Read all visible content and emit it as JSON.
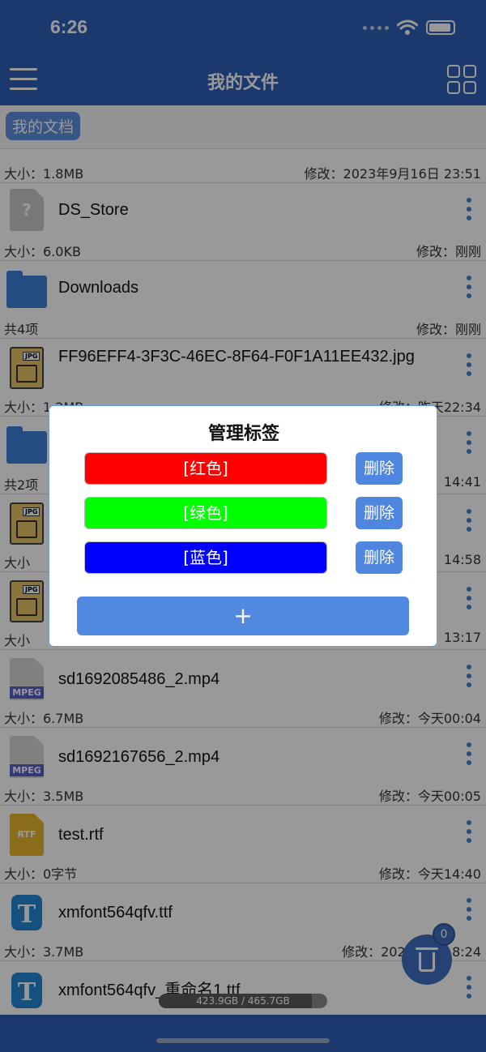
{
  "status_bar": {
    "time": "6:26"
  },
  "nav": {
    "title": "我的文件"
  },
  "breadcrumb": {
    "current": "我的文档"
  },
  "files": [
    {
      "name": "",
      "icon": "generic-file-icon",
      "meta_left": "大小：1.8MB",
      "meta_right": "修改：2023年9月16日 23:51"
    },
    {
      "name": "DS_Store",
      "icon": "unknown-file-icon",
      "glyph": "?",
      "meta_left": "大小：6.0KB",
      "meta_right": "修改：刚刚"
    },
    {
      "name": "Downloads",
      "icon": "folder-icon",
      "meta_left": "共4项",
      "meta_right": "修改：刚刚"
    },
    {
      "name": "FF96EFF4-3F3C-46EC-8F64-F0F1A11EE432.jpg",
      "icon": "jpg-file-icon",
      "tag": "JPG",
      "meta_left": "大小：1.2MB",
      "meta_right": "修改：昨天22:34"
    },
    {
      "name": "",
      "icon": "folder-icon",
      "meta_left": "共2项",
      "meta_right": "14:41"
    },
    {
      "name": "",
      "icon": "jpg-file-icon",
      "tag": "JPG",
      "meta_left": "大小",
      "meta_right": "14:58"
    },
    {
      "name": "",
      "icon": "jpg-file-icon",
      "tag": "JPG",
      "meta_left": "大小",
      "meta_right": "13:17"
    },
    {
      "name": "sd1692085486_2.mp4",
      "icon": "mpeg-file-icon",
      "tag": "MPEG",
      "meta_left": "大小：6.7MB",
      "meta_right": "修改：今天00:04"
    },
    {
      "name": "sd1692167656_2.mp4",
      "icon": "mpeg-file-icon",
      "tag": "MPEG",
      "meta_left": "大小：3.5MB",
      "meta_right": "修改：今天00:05"
    },
    {
      "name": "test.rtf",
      "icon": "rtf-file-icon",
      "tag": "RTF",
      "meta_left": "大小：0字节",
      "meta_right": "修改：今天14:40"
    },
    {
      "name": "xmfont564qfv.ttf",
      "icon": "font-file-icon",
      "tag": "T",
      "meta_left": "大小：3.7MB",
      "meta_right": "修改：2023年8月 8:24"
    },
    {
      "name": "xmfont564qfv_重命名1.ttf",
      "icon": "font-file-icon",
      "tag": "T",
      "meta_left": "",
      "meta_right": ""
    }
  ],
  "storage": {
    "text": "423.9GB / 465.7GB",
    "used_fraction": 0.91
  },
  "trash": {
    "count": "0"
  },
  "dialog": {
    "title": "管理标签",
    "tags": [
      {
        "label": "[红色]",
        "color": "#ff0000",
        "delete_label": "删除"
      },
      {
        "label": "[绿色]",
        "color": "#00ff00",
        "delete_label": "删除"
      },
      {
        "label": "[蓝色]",
        "color": "#0000ff",
        "delete_label": "删除"
      }
    ],
    "add_label": "+"
  }
}
